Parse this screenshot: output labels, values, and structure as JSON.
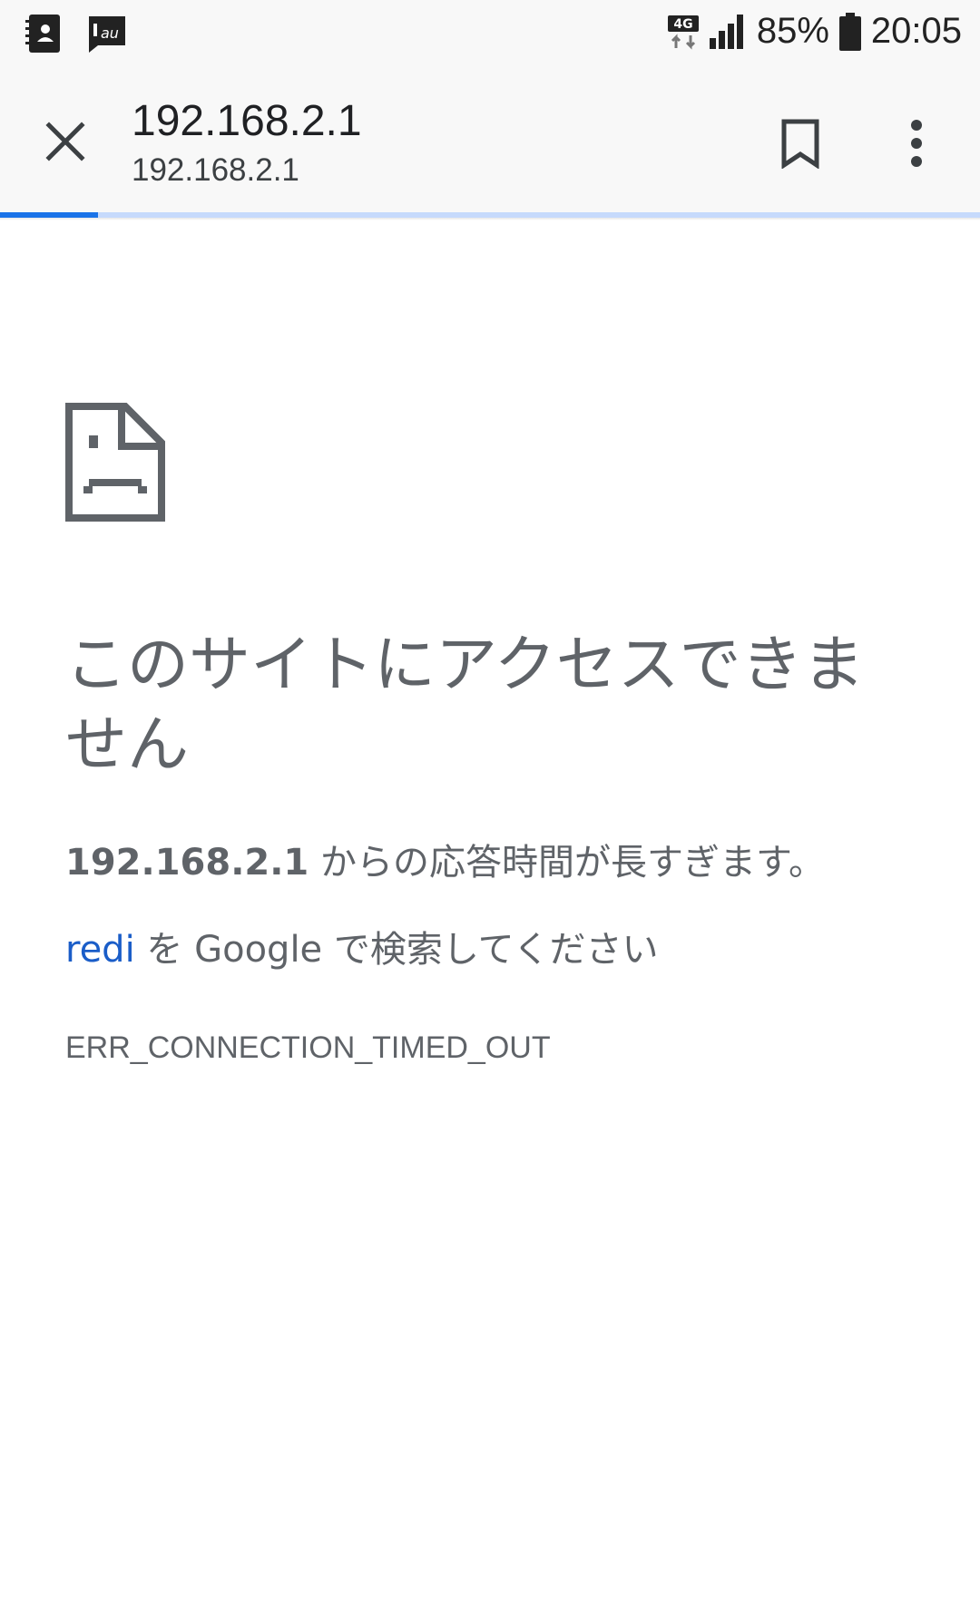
{
  "status_bar": {
    "battery_percent": "85%",
    "time": "20:05",
    "network_label": "4G",
    "carrier_icon_text": "au",
    "icons": [
      "contacts-app-icon",
      "au-carrier-icon",
      "4g-data-icon",
      "signal-icon",
      "battery-icon"
    ]
  },
  "toolbar": {
    "title": "192.168.2.1",
    "subtitle": "192.168.2.1",
    "load_progress": 0.1,
    "icons": [
      "close-icon",
      "bookmark-icon",
      "more-vert-icon"
    ]
  },
  "error_page": {
    "icon": "sad-document-icon",
    "heading": "このサイトにアクセスできません",
    "host": "192.168.2.1",
    "message_rest": " からの応答時間が長すぎます。",
    "search_term": "redi",
    "search_middle": " を Google で検索してください",
    "error_code": "ERR_CONNECTION_TIMED_OUT"
  },
  "colors": {
    "link": "#1a5dc8",
    "progress": "#1a73e8",
    "progress_track": "#c6dafc",
    "text": "#5f6368"
  }
}
